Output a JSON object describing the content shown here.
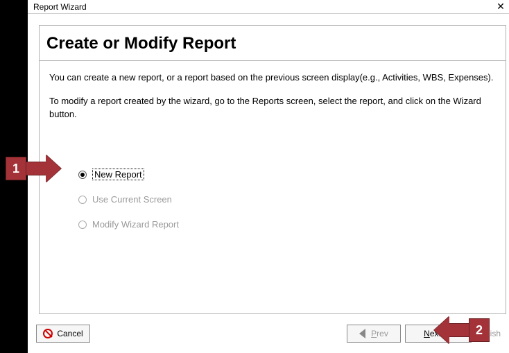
{
  "window": {
    "title": "Report Wizard",
    "close_glyph": "✕"
  },
  "page": {
    "heading": "Create or Modify Report",
    "desc1": "You can create a new report, or a report based on the previous screen display(e.g., Activities, WBS, Expenses).",
    "desc2": "To modify a report created by the wizard, go to the Reports screen, select the report, and click on the Wizard button."
  },
  "options": {
    "new_report": {
      "label": "New Report",
      "selected": true,
      "enabled": true
    },
    "use_current": {
      "label": "Use Current Screen",
      "selected": false,
      "enabled": false
    },
    "modify": {
      "label": "Modify Wizard Report",
      "selected": false,
      "enabled": false
    }
  },
  "buttons": {
    "cancel": "Cancel",
    "prev_u": "P",
    "prev_rest": "rev",
    "next_u": "N",
    "next_rest": "ext",
    "finish": "Finish"
  },
  "callouts": {
    "one": "1",
    "two": "2"
  }
}
